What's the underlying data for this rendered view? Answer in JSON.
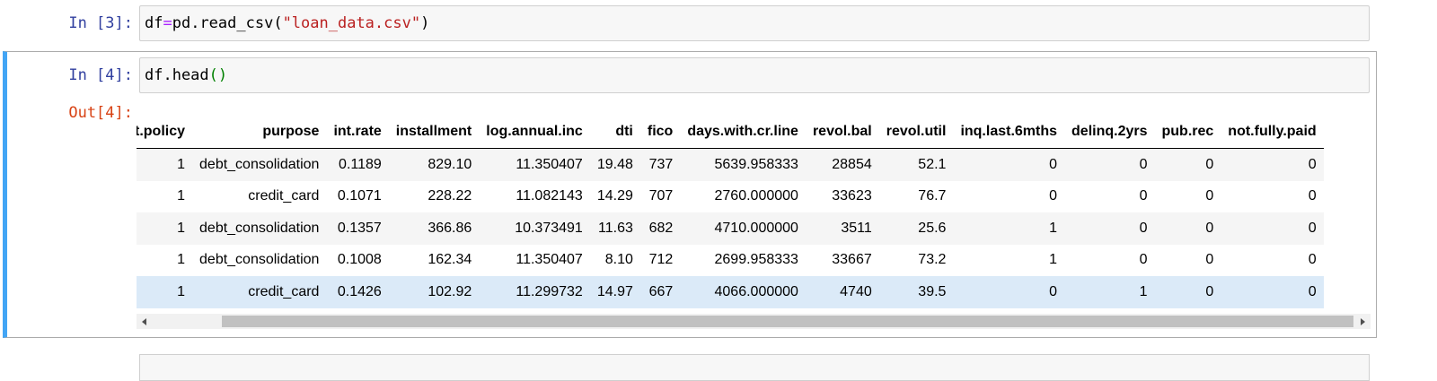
{
  "cells": [
    {
      "prompt": "In [3]:",
      "code": {
        "var": "df",
        "eq": "=",
        "call": "pd.read_csv(",
        "arg": "\"loan_data.csv\"",
        "close": ")"
      }
    },
    {
      "prompt": "In [4]:",
      "code": {
        "call": "df.head",
        "parens": "()"
      },
      "out_prompt": "Out[4]:"
    }
  ],
  "table": {
    "columns": [
      "t.policy",
      "purpose",
      "int.rate",
      "installment",
      "log.annual.inc",
      "dti",
      "fico",
      "days.with.cr.line",
      "revol.bal",
      "revol.util",
      "inq.last.6mths",
      "delinq.2yrs",
      "pub.rec",
      "not.fully.paid"
    ],
    "rows": [
      [
        "1",
        "debt_consolidation",
        "0.1189",
        "829.10",
        "11.350407",
        "19.48",
        "737",
        "5639.958333",
        "28854",
        "52.1",
        "0",
        "0",
        "0",
        "0"
      ],
      [
        "1",
        "credit_card",
        "0.1071",
        "228.22",
        "11.082143",
        "14.29",
        "707",
        "2760.000000",
        "33623",
        "76.7",
        "0",
        "0",
        "0",
        "0"
      ],
      [
        "1",
        "debt_consolidation",
        "0.1357",
        "366.86",
        "10.373491",
        "11.63",
        "682",
        "4710.000000",
        "3511",
        "25.6",
        "1",
        "0",
        "0",
        "0"
      ],
      [
        "1",
        "debt_consolidation",
        "0.1008",
        "162.34",
        "11.350407",
        "8.10",
        "712",
        "2699.958333",
        "33667",
        "73.2",
        "1",
        "0",
        "0",
        "0"
      ],
      [
        "1",
        "credit_card",
        "0.1426",
        "102.92",
        "11.299732",
        "14.97",
        "667",
        "4066.000000",
        "4740",
        "39.5",
        "0",
        "1",
        "0",
        "0"
      ]
    ],
    "hovered_row": 4
  },
  "colors": {
    "input_prompt": "#303f9f",
    "output_prompt": "#d84315",
    "selected_cell_bar": "#42a5f5",
    "string": "#ba2121",
    "operator": "#aa22ff",
    "paren": "#008000",
    "row_hover": "#dbeaf8"
  }
}
